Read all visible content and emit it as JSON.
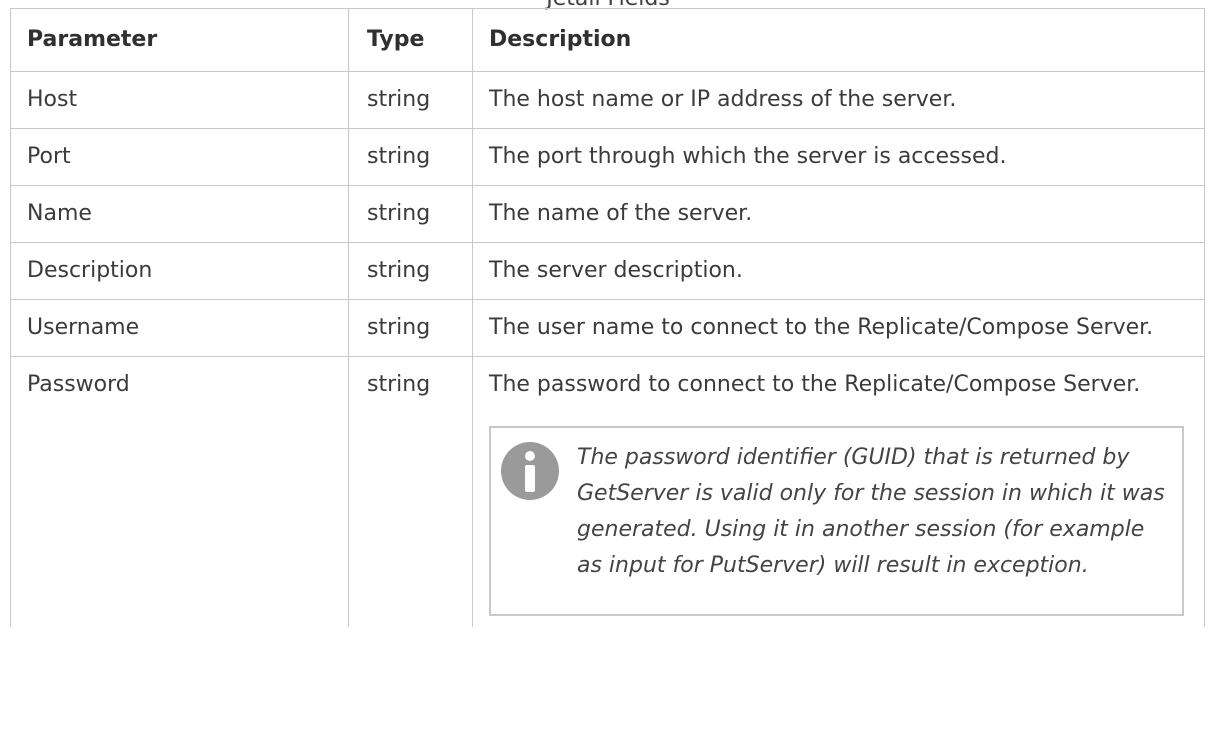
{
  "caption": "Jetail Fields",
  "table": {
    "headers": {
      "parameter": "Parameter",
      "type": "Type",
      "description": "Description"
    },
    "rows": [
      {
        "parameter": "Host",
        "type": "string",
        "description": "The host name or IP address of the server."
      },
      {
        "parameter": "Port",
        "type": "string",
        "description": "The port through which the server is accessed."
      },
      {
        "parameter": "Name",
        "type": "string",
        "description": "The name of the server."
      },
      {
        "parameter": "Description",
        "type": "string",
        "description": "The server description."
      },
      {
        "parameter": "Username",
        "type": "string",
        "description": "The user name to connect to the Replicate/Compose Server."
      },
      {
        "parameter": "Password",
        "type": "string",
        "description": "The password to connect to the Replicate/Compose Server."
      }
    ]
  },
  "note": {
    "icon": "info-icon",
    "text": "The password identifier (GUID) that is returned by GetServer is valid only for the session in which it was generated. Using it in another session (for example as input for PutServer) will result in exception."
  },
  "colors": {
    "border": "#c8c8c8",
    "text": "#3b3b3b",
    "icon": "#9a9a9a"
  }
}
